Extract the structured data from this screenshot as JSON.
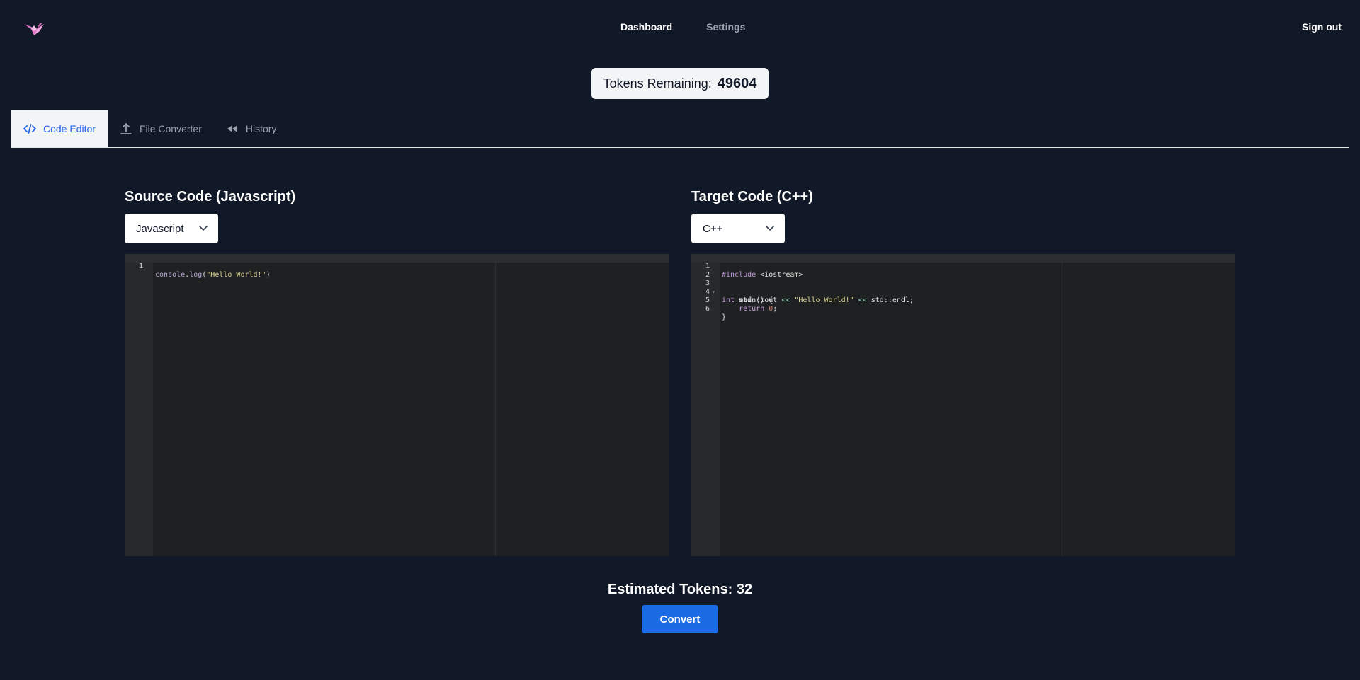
{
  "header": {
    "logo_icon": "origami-crane-icon",
    "nav": [
      {
        "label": "Dashboard",
        "active": true
      },
      {
        "label": "Settings",
        "active": false
      }
    ],
    "sign_out": "Sign out"
  },
  "tokens": {
    "label": "Tokens Remaining:",
    "value": "49604"
  },
  "tabs": [
    {
      "label": "Code Editor",
      "icon": "code-icon",
      "active": true
    },
    {
      "label": "File Converter",
      "icon": "upload-icon",
      "active": false
    },
    {
      "label": "History",
      "icon": "rewind-icon",
      "active": false
    }
  ],
  "source": {
    "title": "Source Code (Javascript)",
    "language": "Javascript",
    "line_numbers": [
      "1"
    ]
  },
  "target": {
    "title": "Target Code (C++)",
    "language": "C++",
    "line_numbers": [
      "1",
      "2",
      "3",
      "4",
      "5",
      "6"
    ]
  },
  "estimate": {
    "label": "Estimated Tokens:",
    "value": "32"
  },
  "convert_label": "Convert",
  "colors": {
    "background": "#111827",
    "accent": "#1d6ae5",
    "active_tab_text": "#2563eb",
    "editor_bg": "#1f2022"
  }
}
